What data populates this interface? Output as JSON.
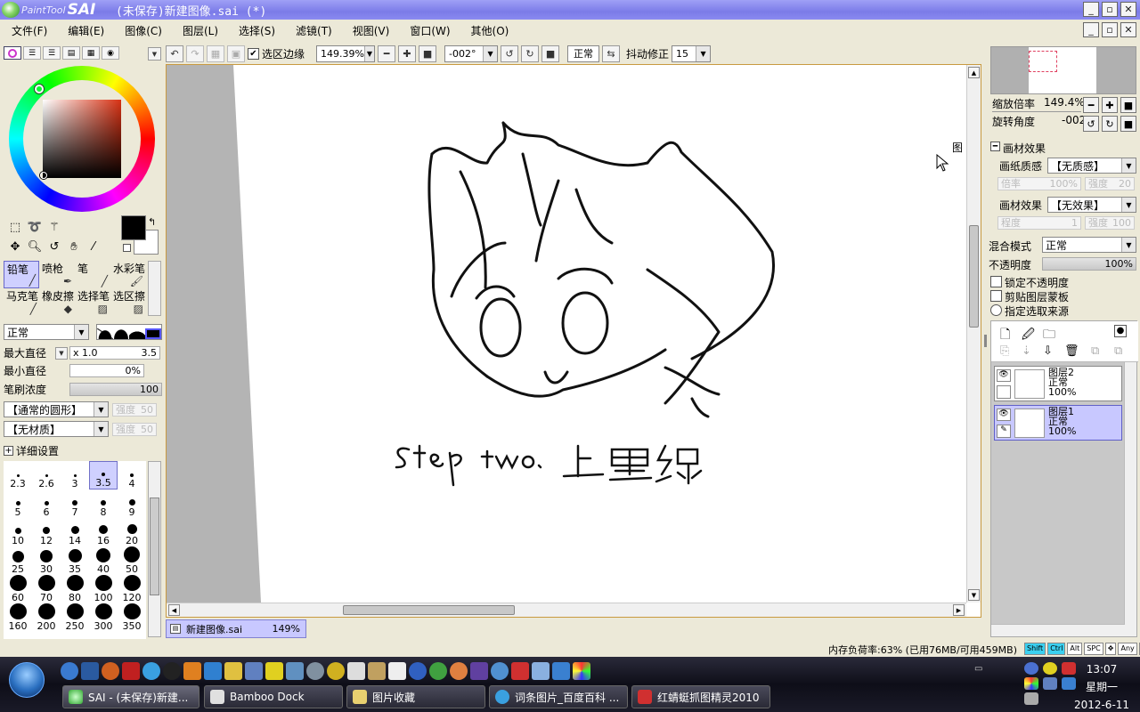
{
  "app": {
    "logo_small": "PaintTool",
    "logo_big": "SAI",
    "window_title": "(未保存)新建图像.sai (*)"
  },
  "menu": [
    "文件(F)",
    "编辑(E)",
    "图像(C)",
    "图层(L)",
    "选择(S)",
    "滤镜(T)",
    "视图(V)",
    "窗口(W)",
    "其他(O)"
  ],
  "toolbar": {
    "selection_edge_label": "选区边缘",
    "selection_edge_checked": true,
    "zoom": "149.39%",
    "rotation": "-002°",
    "blend": "正常",
    "stabilizer_label": "抖动修正",
    "stabilizer": "15"
  },
  "brushes": [
    {
      "label": "铅笔",
      "active": true
    },
    {
      "label": "喷枪",
      "active": false
    },
    {
      "label": "笔",
      "active": false
    },
    {
      "label": "水彩笔",
      "active": false
    },
    {
      "label": "马克笔",
      "active": false
    },
    {
      "label": "橡皮擦",
      "active": false
    },
    {
      "label": "选择笔",
      "active": false
    },
    {
      "label": "选区擦",
      "active": false
    }
  ],
  "brush_settings": {
    "mode": "正常",
    "max_diameter_label": "最大直径",
    "max_multiplier": "x 1.0",
    "max_value": "3.5",
    "min_diameter_label": "最小直径",
    "min_value": "0%",
    "density_label": "笔刷浓度",
    "density_value": "100",
    "shape": "【通常的圆形】",
    "shape_strength": "强度",
    "shape_strength_value": "50",
    "texture": "【无材质】",
    "texture_strength": "强度",
    "texture_strength_value": "50",
    "detail_label": "详细设置"
  },
  "sizes": [
    "2.3",
    "2.6",
    "3",
    "3.5",
    "4",
    "5",
    "6",
    "7",
    "8",
    "9",
    "10",
    "12",
    "14",
    "16",
    "20",
    "25",
    "30",
    "35",
    "40",
    "50",
    "60",
    "70",
    "80",
    "100",
    "120",
    "160",
    "200",
    "250",
    "300",
    "350"
  ],
  "active_size": "3.5",
  "canvas": {
    "caption": "Step two: 上墨线",
    "corner_text": "图"
  },
  "doc_tab": {
    "name": "新建图像.sai",
    "zoom": "149%"
  },
  "navigator": {
    "zoom_label": "缩放倍率",
    "zoom_value": "149.4%",
    "rotate_label": "旋转角度",
    "rotate_value": "-002"
  },
  "paper": {
    "section_label": "画材效果",
    "texture_label": "画纸质感",
    "texture_value": "【无质感】",
    "scale_label": "倍率",
    "scale_value": "100%",
    "strength_label": "强度",
    "strength_value": "20",
    "effect_label": "画材效果",
    "effect_value": "【无效果】",
    "degree_label": "程度",
    "degree_value": "1",
    "strength2_label": "强度",
    "strength2_value": "100"
  },
  "layer_settings": {
    "blend_label": "混合模式",
    "blend_value": "正常",
    "opacity_label": "不透明度",
    "opacity_value": "100%",
    "lock_label": "锁定不透明度",
    "clip_label": "剪贴图层蒙板",
    "source_label": "指定选取来源"
  },
  "layers": [
    {
      "name": "图层2",
      "mode": "正常",
      "opacity": "100%",
      "active": false
    },
    {
      "name": "图层1",
      "mode": "正常",
      "opacity": "100%",
      "active": true
    }
  ],
  "status": {
    "memory": "内存负荷率:63% (已用76MB/可用459MB)",
    "keys": [
      "Shift",
      "Ctrl",
      "Alt",
      "SPC",
      "✥",
      "Any",
      "✎"
    ]
  },
  "taskbar": {
    "tasks": [
      "SAI - (未保存)新建...",
      "Bamboo Dock",
      "图片收藏",
      "词条图片_百度百科 ...",
      "红蜻蜓抓图精灵2010"
    ],
    "time": "13:07",
    "weekday": "星期一",
    "date": "2012-6-11"
  },
  "colors": {
    "title_bar": "#8a8af0",
    "active_highlight": "#c8c8ff",
    "fg_color": "#000000",
    "bg_color": "#ffffff"
  }
}
